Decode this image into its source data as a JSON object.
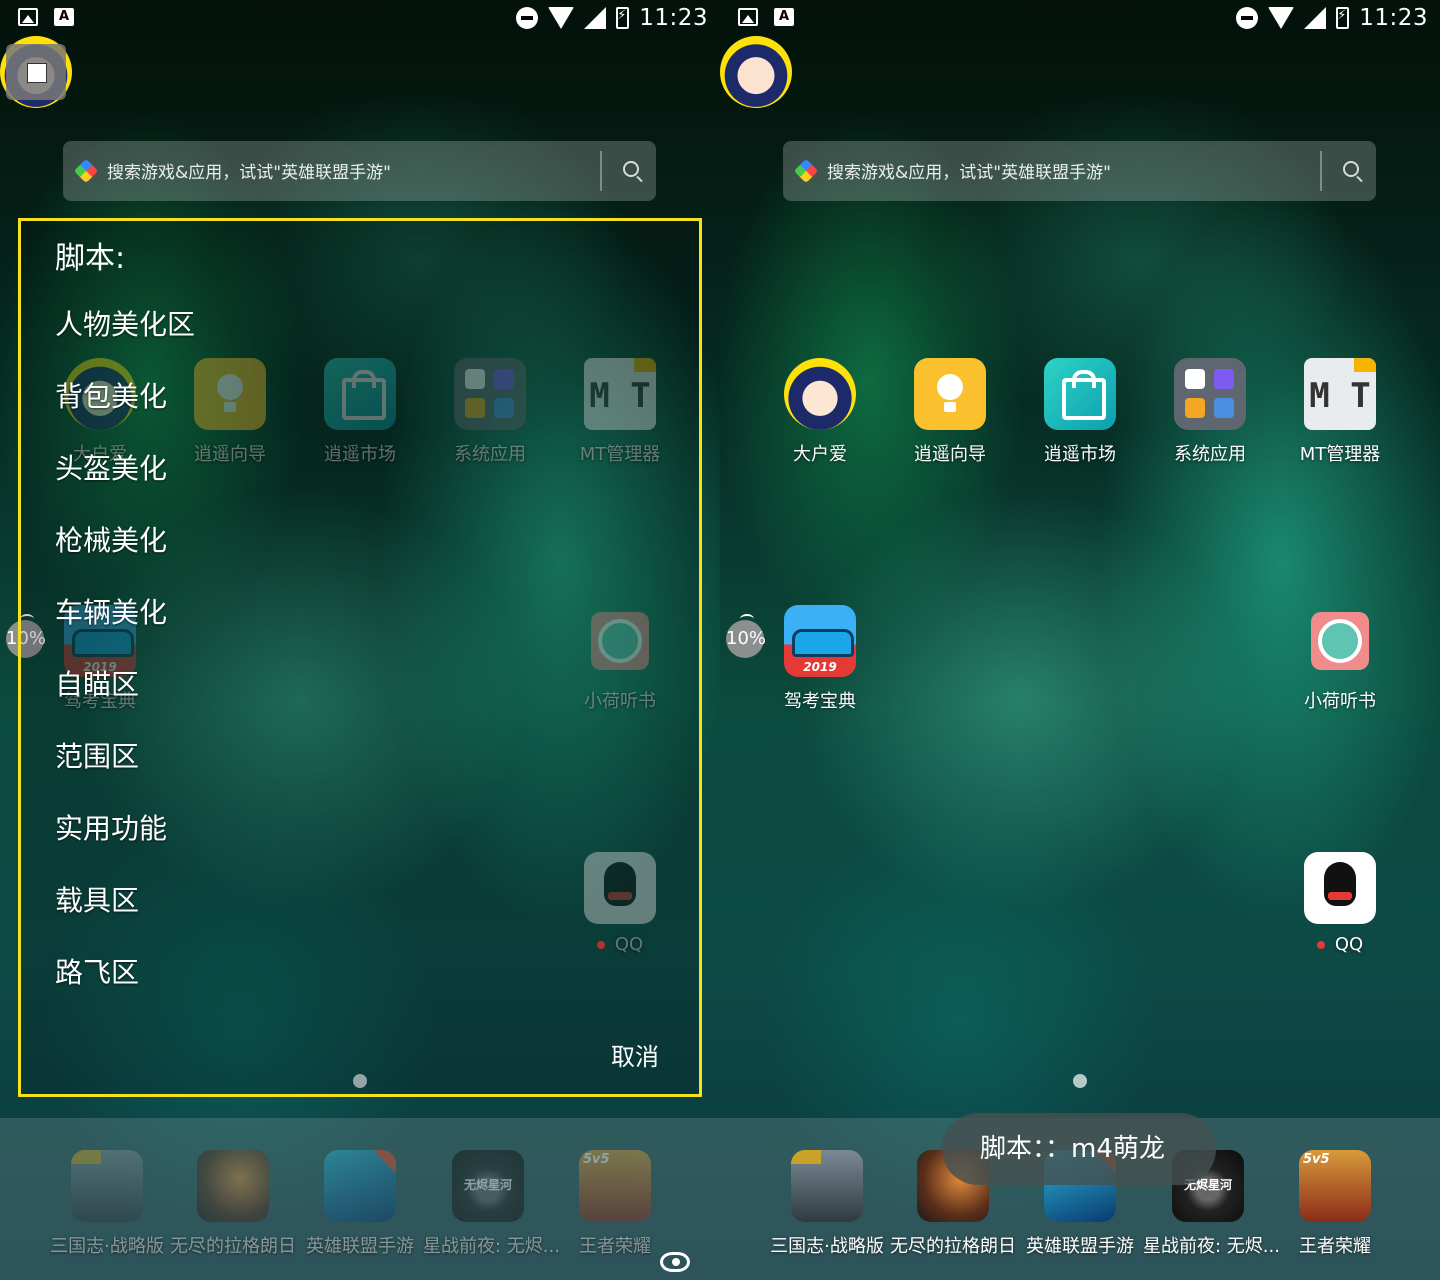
{
  "status_bar": {
    "time": "11:23"
  },
  "search": {
    "placeholder": "搜索游戏&应用，试试\"英雄联盟手游\""
  },
  "apps": {
    "row1": [
      "大户爱",
      "逍遥向导",
      "逍遥市场",
      "系统应用",
      "MT管理器"
    ],
    "jiakao": "驾考宝典",
    "xiaohe": "小荷听书",
    "qq": "QQ"
  },
  "progress_badge": "10%",
  "dock": [
    "三国志·战略版",
    "无尽的拉格朗日",
    "英雄联盟手游",
    "星战前夜: 无烬...",
    "王者荣耀"
  ],
  "script_menu": {
    "title": "脚本:",
    "items": [
      "人物美化区",
      "背包美化",
      "头盔美化",
      "枪械美化",
      "车辆美化",
      "自瞄区",
      "范围区",
      "实用功能",
      "载具区",
      "路飞区"
    ],
    "cancel": "取消"
  },
  "toast": {
    "text": "脚本：：m4萌龙"
  },
  "colors": {
    "menu_border": "#f5e21a",
    "qq_dot": "#e53935"
  }
}
